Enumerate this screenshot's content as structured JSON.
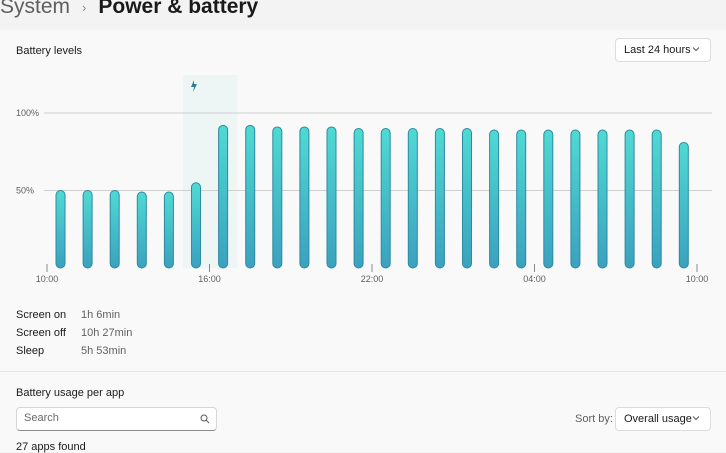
{
  "breadcrumb": {
    "parent": "System",
    "separator": "›",
    "current": "Power & battery"
  },
  "battery_card": {
    "title": "Battery levels",
    "range_dropdown": {
      "value": "Last 24 hours"
    }
  },
  "chart_data": {
    "type": "bar",
    "series": [
      {
        "values": [
          50,
          50,
          50,
          49,
          49,
          55,
          92,
          92,
          91,
          91,
          91,
          90,
          90,
          90,
          90,
          90,
          89,
          89,
          89,
          89,
          89,
          89,
          89,
          81
        ]
      }
    ],
    "x_tick_labels": [
      "10:00",
      "16:00",
      "22:00",
      "04:00",
      "10:00"
    ],
    "y_tick_labels": [
      "100%",
      "50%"
    ],
    "ylim": [
      0,
      100
    ],
    "charging_period": {
      "start_bar": 5,
      "end_bar": 6,
      "icon": "lightning-icon"
    },
    "grid": true,
    "colors": {
      "bar_top": "#4fdad3",
      "bar_bottom": "#3ba1be",
      "bar_stroke": "#2d8aa3",
      "charge_band": "#eef6f5",
      "charge_icon": "#2b7f94"
    }
  },
  "usage_stats": [
    {
      "label": "Screen on",
      "value": "1h 6min"
    },
    {
      "label": "Screen off",
      "value": "10h 27min"
    },
    {
      "label": "Sleep",
      "value": "5h 53min"
    }
  ],
  "app_usage": {
    "title": "Battery usage per app",
    "search_placeholder": "Search",
    "sort_label": "Sort by:",
    "sort_value": "Overall usage",
    "apps_found": "27 apps found"
  }
}
